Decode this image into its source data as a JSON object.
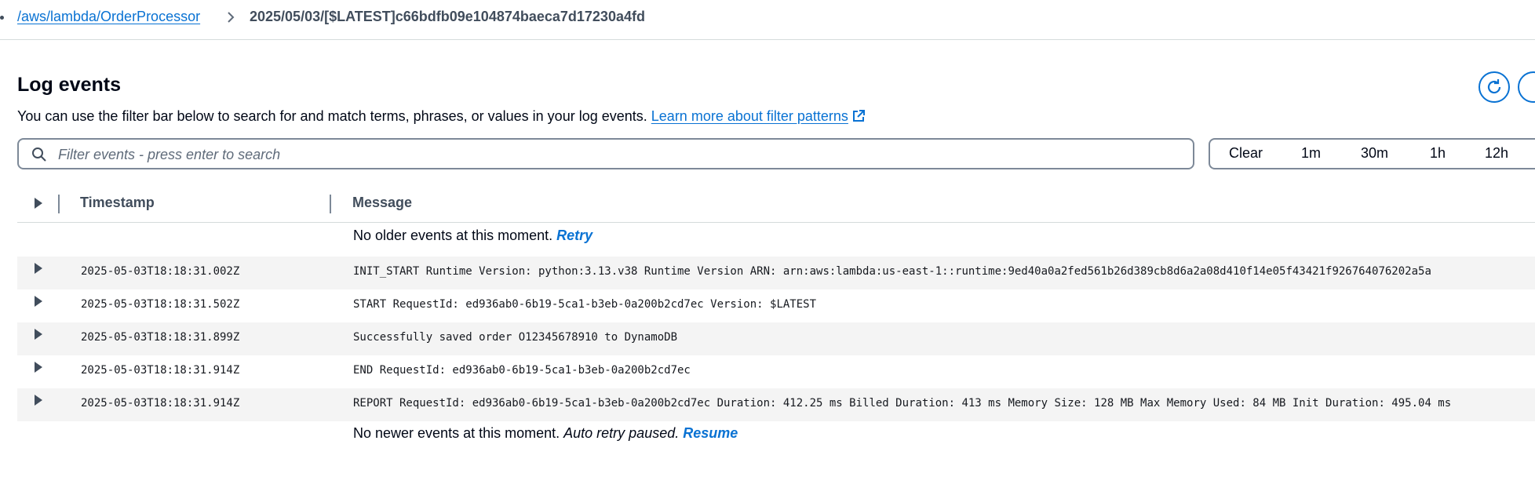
{
  "breadcrumb": {
    "log_group": "/aws/lambda/OrderProcessor",
    "log_stream": "2025/05/03/[$LATEST]c66bdfb09e104874baeca7d17230a4fd"
  },
  "header": {
    "title": "Log events",
    "description": "You can use the filter bar below to search for and match terms, phrases, or values in your log events.",
    "learn_more": "Learn more about filter patterns"
  },
  "filter": {
    "placeholder": "Filter events - press enter to search",
    "value": ""
  },
  "time_range": {
    "clear": "Clear",
    "options": [
      "1m",
      "30m",
      "1h",
      "12h"
    ]
  },
  "table": {
    "columns": {
      "timestamp": "Timestamp",
      "message": "Message"
    },
    "older": {
      "text": "No older events at this moment.",
      "action": "Retry"
    },
    "newer": {
      "text": "No newer events at this moment.",
      "status": "Auto retry paused.",
      "action": "Resume"
    },
    "rows": [
      {
        "timestamp": "2025-05-03T18:18:31.002Z",
        "message": "INIT_START Runtime Version: python:3.13.v38 Runtime Version ARN: arn:aws:lambda:us-east-1::runtime:9ed40a0a2fed561b26d389cb8d6a2a08d410f14e05f43421f926764076202a5a"
      },
      {
        "timestamp": "2025-05-03T18:18:31.502Z",
        "message": "START RequestId: ed936ab0-6b19-5ca1-b3eb-0a200b2cd7ec Version: $LATEST"
      },
      {
        "timestamp": "2025-05-03T18:18:31.899Z",
        "message": "Successfully saved order O12345678910 to DynamoDB"
      },
      {
        "timestamp": "2025-05-03T18:18:31.914Z",
        "message": "END RequestId: ed936ab0-6b19-5ca1-b3eb-0a200b2cd7ec"
      },
      {
        "timestamp": "2025-05-03T18:18:31.914Z",
        "message": "REPORT RequestId: ed936ab0-6b19-5ca1-b3eb-0a200b2cd7ec Duration: 412.25 ms Billed Duration: 413 ms Memory Size: 128 MB Max Memory Used: 84 MB Init Duration: 495.04 ms"
      }
    ]
  },
  "icons": {
    "breadcrumb_separator": "chevron-right-icon",
    "refresh": "refresh-icon",
    "external_link": "external-link-icon",
    "search": "search-icon",
    "expand": "caret-right-icon"
  },
  "colors": {
    "link": "#0972d3",
    "text": "#000716",
    "row_shade": "#f4f4f4",
    "border": "#7d8998"
  }
}
